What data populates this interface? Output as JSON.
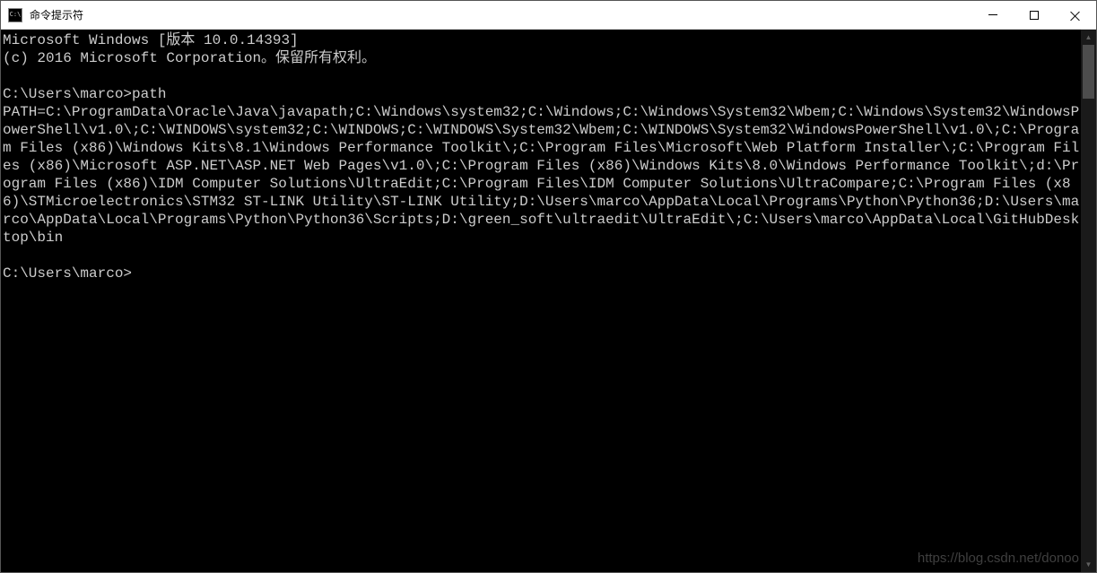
{
  "window": {
    "title": "命令提示符",
    "icon_text": "C:\\"
  },
  "terminal": {
    "header_line1": "Microsoft Windows [版本 10.0.14393]",
    "header_line2": "(c) 2016 Microsoft Corporation。保留所有权利。",
    "prompt1": "C:\\Users\\marco>",
    "command1": "path",
    "output": "PATH=C:\\ProgramData\\Oracle\\Java\\javapath;C:\\Windows\\system32;C:\\Windows;C:\\Windows\\System32\\Wbem;C:\\Windows\\System32\\WindowsPowerShell\\v1.0\\;C:\\WINDOWS\\system32;C:\\WINDOWS;C:\\WINDOWS\\System32\\Wbem;C:\\WINDOWS\\System32\\WindowsPowerShell\\v1.0\\;C:\\Program Files (x86)\\Windows Kits\\8.1\\Windows Performance Toolkit\\;C:\\Program Files\\Microsoft\\Web Platform Installer\\;C:\\Program Files (x86)\\Microsoft ASP.NET\\ASP.NET Web Pages\\v1.0\\;C:\\Program Files (x86)\\Windows Kits\\8.0\\Windows Performance Toolkit\\;d:\\Program Files (x86)\\IDM Computer Solutions\\UltraEdit;C:\\Program Files\\IDM Computer Solutions\\UltraCompare;C:\\Program Files (x86)\\STMicroelectronics\\STM32 ST-LINK Utility\\ST-LINK Utility;D:\\Users\\marco\\AppData\\Local\\Programs\\Python\\Python36;D:\\Users\\marco\\AppData\\Local\\Programs\\Python\\Python36\\Scripts;D:\\green_soft\\ultraedit\\UltraEdit\\;C:\\Users\\marco\\AppData\\Local\\GitHubDesktop\\bin",
    "prompt2": "C:\\Users\\marco>"
  },
  "watermark": "https://blog.csdn.net/donoo"
}
